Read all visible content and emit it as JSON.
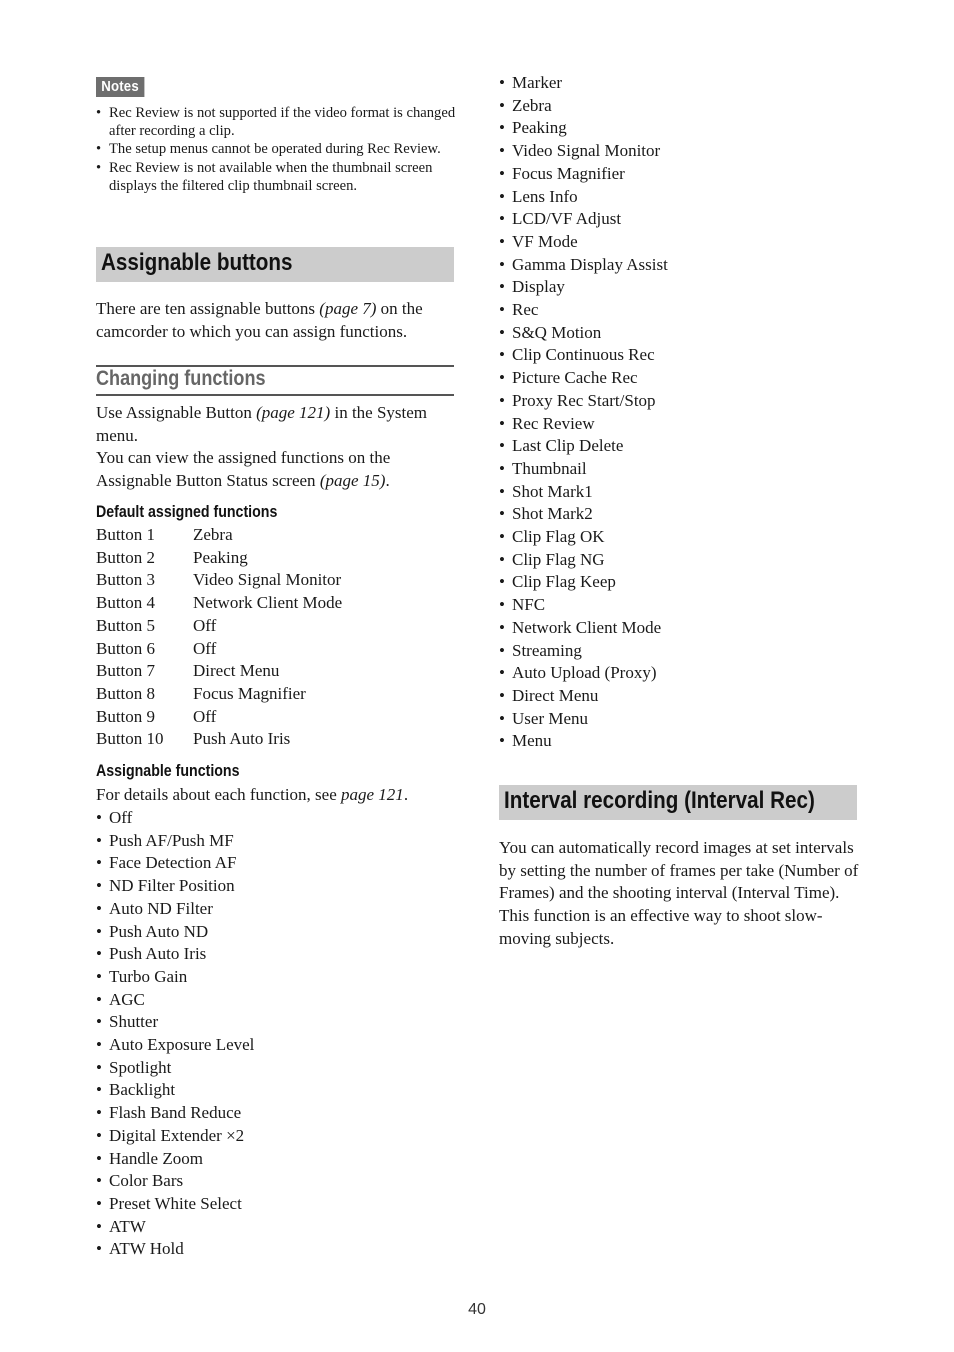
{
  "notes": {
    "label": "Notes",
    "items": [
      "Rec Review is not supported if the video format is changed after recording a clip.",
      "The setup menus cannot be operated during Rec Review.",
      "Rec Review is not available when the thumbnail screen displays the filtered clip thumbnail screen."
    ]
  },
  "assignable_buttons": {
    "title": "Assignable buttons",
    "intro_pre": "There are ten assignable buttons ",
    "intro_ref": "(page 7)",
    "intro_post": " on the camcorder to which you can assign functions."
  },
  "changing_functions": {
    "title": "Changing functions",
    "p1_pre": "Use Assignable Button ",
    "p1_ref": "(page 121)",
    "p1_post": " in the System menu.",
    "p2_pre": "You can view the assigned functions on the Assignable Button Status screen ",
    "p2_ref": "(page 15)",
    "p2_post": "."
  },
  "default_assigned": {
    "title": "Default assigned functions",
    "rows": [
      {
        "button": "Button 1",
        "function": "Zebra"
      },
      {
        "button": "Button 2",
        "function": "Peaking"
      },
      {
        "button": "Button 3",
        "function": "Video Signal Monitor"
      },
      {
        "button": "Button 4",
        "function": "Network Client Mode"
      },
      {
        "button": "Button 5",
        "function": "Off"
      },
      {
        "button": "Button 6",
        "function": "Off"
      },
      {
        "button": "Button 7",
        "function": "Direct Menu"
      },
      {
        "button": "Button 8",
        "function": "Focus Magnifier"
      },
      {
        "button": "Button 9",
        "function": "Off"
      },
      {
        "button": "Button 10",
        "function": "Push Auto Iris"
      }
    ]
  },
  "assignable_functions": {
    "title": "Assignable functions",
    "details_pre": "For details about each function, see ",
    "details_ref": "page 121",
    "details_post": ".",
    "left_items": [
      "Off",
      "Push AF/Push MF",
      "Face Detection AF",
      "ND Filter Position",
      "Auto ND Filter",
      "Push Auto ND",
      "Push Auto Iris",
      "Turbo Gain",
      "AGC",
      "Shutter",
      "Auto Exposure Level",
      "Spotlight",
      "Backlight",
      "Flash Band Reduce",
      "Digital Extender ×2",
      "Handle Zoom",
      "Color Bars",
      "Preset White Select",
      "ATW",
      "ATW Hold"
    ],
    "right_items": [
      "Marker",
      "Zebra",
      "Peaking",
      "Video Signal Monitor",
      "Focus Magnifier",
      "Lens Info",
      "LCD/VF Adjust",
      "VF Mode",
      "Gamma Display Assist",
      "Display",
      "Rec",
      "S&Q Motion",
      "Clip Continuous Rec",
      "Picture Cache Rec",
      "Proxy Rec Start/Stop",
      "Rec Review",
      "Last Clip Delete",
      "Thumbnail",
      "Shot Mark1",
      "Shot Mark2",
      "Clip Flag OK",
      "Clip Flag NG",
      "Clip Flag Keep",
      "NFC",
      "Network Client Mode",
      "Streaming",
      "Auto Upload (Proxy)",
      "Direct Menu",
      "User Menu",
      "Menu"
    ]
  },
  "interval_recording": {
    "title": "Interval recording (Interval Rec)",
    "p1": "You can automatically record images at set intervals by setting the number of frames per take (Number of Frames) and the shooting interval (Interval Time).",
    "p2": "This function is an effective way to shoot slow-moving subjects."
  },
  "page_number": "40"
}
